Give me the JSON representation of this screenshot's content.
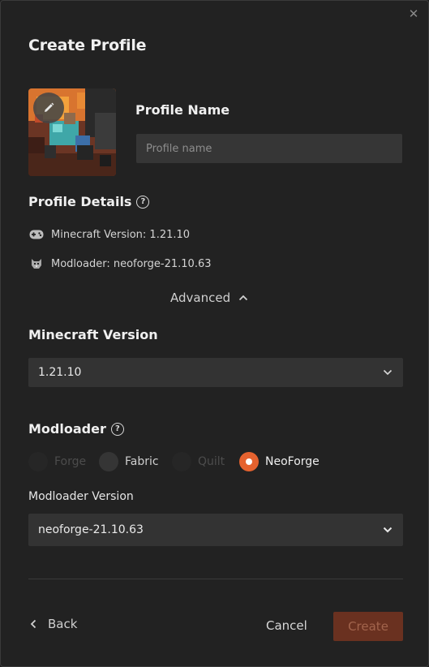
{
  "dialog": {
    "title": "Create Profile",
    "close_icon": "close-icon"
  },
  "profile_name": {
    "label": "Profile Name",
    "value": "",
    "placeholder": "Profile name"
  },
  "profile_details": {
    "heading": "Profile Details",
    "minecraft_version": "Minecraft Version: 1.21.10",
    "modloader": "Modloader: neoforge-21.10.63"
  },
  "advanced": {
    "label": "Advanced",
    "expanded": true
  },
  "minecraft_version": {
    "label": "Minecraft Version",
    "selected": "1.21.10"
  },
  "modloader": {
    "label": "Modloader",
    "options": [
      "Forge",
      "Fabric",
      "Quilt",
      "NeoForge"
    ],
    "selected": "NeoForge",
    "version_label": "Modloader Version",
    "version_selected": "neoforge-21.10.63"
  },
  "footer": {
    "back_label": "Back",
    "cancel_label": "Cancel",
    "create_label": "Create"
  },
  "colors": {
    "accent": "#e5622f",
    "background": "#222222",
    "input_bg": "#333333"
  }
}
